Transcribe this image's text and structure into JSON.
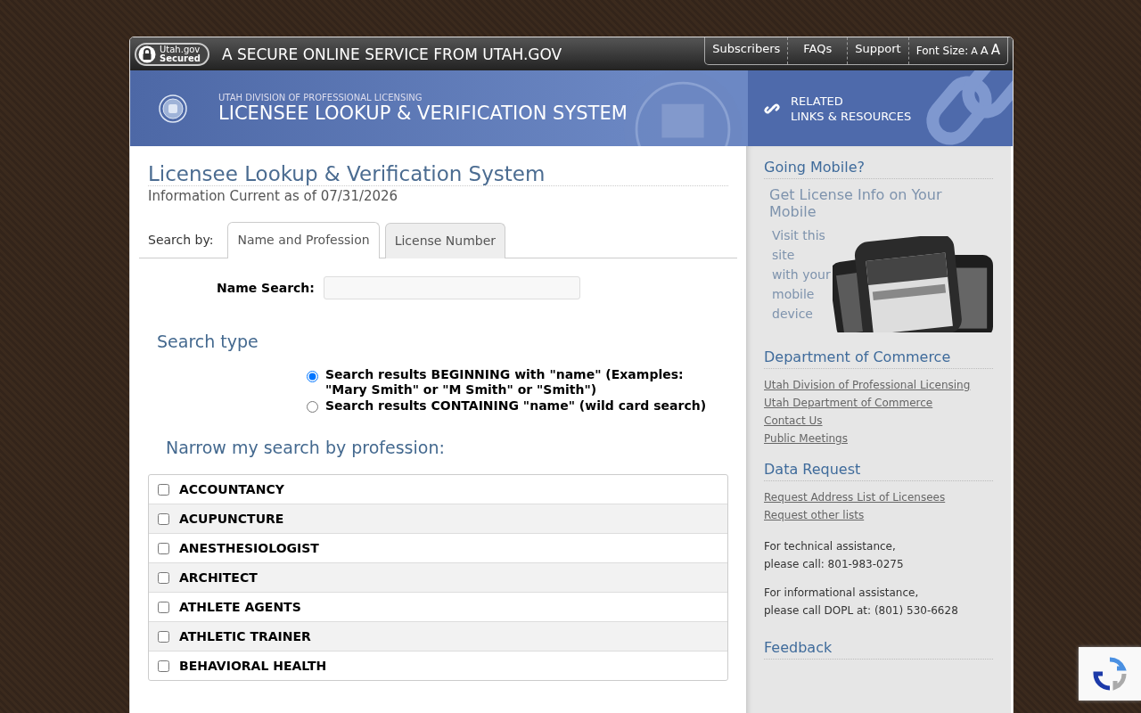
{
  "top_bar": {
    "badge": [
      "Utah.gov",
      "Secured"
    ],
    "tagline": "A SECURE ONLINE SERVICE FROM UTAH.GOV",
    "links": [
      "Subscribers",
      "FAQs",
      "Support"
    ],
    "font_size": {
      "label": "Font Size:",
      "sizes": [
        "A",
        "A",
        "A"
      ]
    }
  },
  "banner": {
    "subtitle": "UTAH DIVISION OF PROFESSIONAL LICENSING",
    "title": "LICENSEE LOOKUP & VERIFICATION SYSTEM",
    "related": [
      "RELATED",
      "LINKS & RESOURCES"
    ]
  },
  "main": {
    "title": "Licensee Lookup & Verification System",
    "info": "Information Current as of 07/31/2026",
    "search_by": "Search by:",
    "tabs": [
      {
        "label": "Name and Profession",
        "selected": true
      },
      {
        "label": "License Number",
        "selected": false
      }
    ],
    "name_search": {
      "label": "Name Search:"
    },
    "search_type": {
      "heading": "Search type",
      "options": [
        {
          "label": "Search results BEGINNING with \"name\" (Examples: \"Mary Smith\" or \"M Smith\" or \"Smith\")",
          "selected": true
        },
        {
          "label": "Search results CONTAINING \"name\" (wild card search)",
          "selected": false
        }
      ]
    },
    "profession_heading": "Narrow my search by profession:",
    "professions": [
      {
        "label": "ACCOUNTANCY",
        "checked": false
      },
      {
        "label": "ACUPUNCTURE",
        "checked": false
      },
      {
        "label": "ANESTHESIOLOGIST",
        "checked": false
      },
      {
        "label": "ARCHITECT",
        "checked": false
      },
      {
        "label": "ATHLETE AGENTS",
        "checked": false
      },
      {
        "label": "ATHLETIC TRAINER",
        "checked": false
      },
      {
        "label": "BEHAVIORAL HEALTH",
        "checked": false
      }
    ]
  },
  "sidebar": {
    "mobile": {
      "heading": "Going Mobile?",
      "promo_title": "Get License Info on Your Mobile",
      "promo_text": [
        "Visit this site",
        "with your",
        "mobile",
        "device"
      ]
    },
    "sections": [
      {
        "heading": "Department of Commerce",
        "links": [
          "Utah Division of Professional Licensing",
          "Utah Department of Commerce",
          "Contact Us",
          "Public Meetings"
        ]
      },
      {
        "heading": "Data Request",
        "links": [
          "Request Address List of Licensees",
          "Request other lists"
        ]
      }
    ],
    "assistance": [
      [
        "For technical assistance,",
        "please call: 801-983-0275"
      ],
      [
        "For informational assistance,",
        "please call DOPL at: (801) 530-6628"
      ]
    ],
    "feedback": "Feedback"
  }
}
